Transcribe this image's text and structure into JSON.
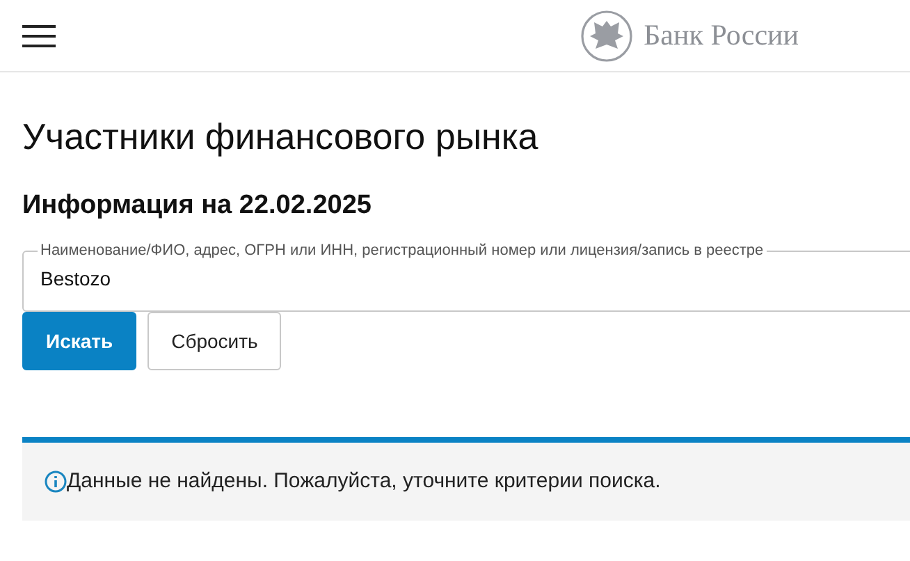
{
  "header": {
    "brand": "Банк России"
  },
  "page_title": "Участники финансового рынка",
  "info_date": "Информация на 22.02.2025",
  "search": {
    "label": "Наименование/ФИО, адрес, ОГРН или ИНН, регистрационный номер или лицензия/запись в реестре",
    "value": "Bestozo"
  },
  "buttons": [
    {
      "label": "Искать",
      "kind": "primary"
    },
    {
      "label": "Сбросить",
      "kind": "secondary"
    }
  ],
  "alert": {
    "message": "Данные не найдены. Пожалуйста, уточните критерии поиска."
  }
}
